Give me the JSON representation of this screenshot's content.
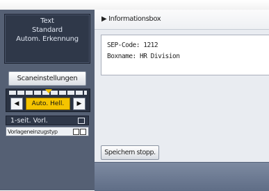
{
  "left_panel": {
    "mode_lines": [
      "Text",
      "Standard",
      "Autom. Erkennung"
    ],
    "scan_settings_label": "Scaneinstellungen",
    "density_button_label": "Auto. Hell.",
    "left_arrow": "◀",
    "right_arrow": "▶",
    "one_sided_label": "1-seit. Vorl.",
    "original_type_label": "Vorlageneinzugstyp"
  },
  "main": {
    "header_marker": "▶",
    "header_title": "Informationsbox",
    "info": {
      "sep_code_label": "SEP-Code:",
      "sep_code_value": "1212",
      "box_name_label": "Boxname:",
      "box_name_value": "HR Division"
    },
    "save_stop_label": "Speichern stopp."
  },
  "colors": {
    "panel_bg": "#556074",
    "accent_yellow": "#f5c400",
    "content_bg": "#e9ecf1"
  }
}
